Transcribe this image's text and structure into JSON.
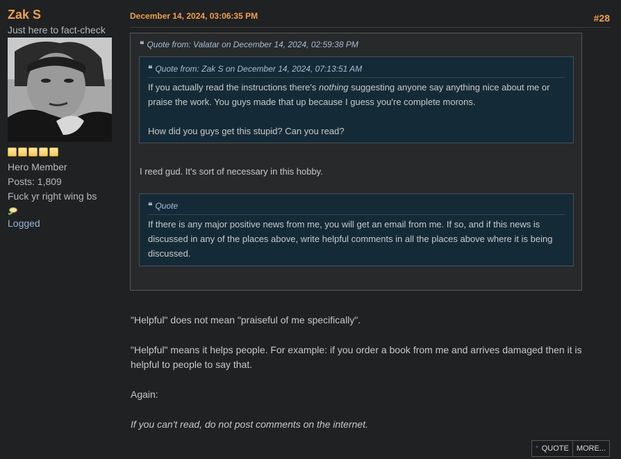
{
  "poster": {
    "name": "Zak S",
    "title": "Just here to fact-check",
    "rank": "Hero Member",
    "posts": "Posts: 1,809",
    "signature_line": "Fuck yr right wing bs",
    "logged": "Logged",
    "stars": 5,
    "star_color": "#f3c95a",
    "name_color": "#f0a04b"
  },
  "post": {
    "date": "December 14, 2024, 03:06:35 PM",
    "number": "#28",
    "outer_quote": {
      "cite": "Quote from: Valatar on December 14, 2024, 02:59:38 PM",
      "inner_quote": {
        "cite": "Quote from: Zak S on December 14, 2024, 07:13:51 AM",
        "line1_pre": "If you actually read the instructions there's ",
        "line1_em": "nothing",
        "line1_post": " suggesting anyone say anything nice about me or praise the work. You guys made that up because I guess you're complete morons.",
        "line2": "How did you guys get this stupid? Can you read?"
      },
      "reply": "I reed gud.  It's sort of necessary in this hobby.",
      "second_quote": {
        "cite": "Quote",
        "text": "If there is any major positive news from me, you will get an email from me. If so, and if this news is discussed in any of the places above, write helpful comments in all the places above where it is being discussed."
      }
    },
    "body": [
      "\"Helpful\" does not mean \"praiseful of me specifically\".",
      "\"Helpful\" means it helps people. For example: if you order a book from me and arrives damaged then it is helpful to people to say that.",
      "Again:",
      "If you can't read, do not post comments on the internet."
    ]
  },
  "buttons": {
    "quote_icon": "“",
    "quote": "QUOTE",
    "more": "MORE..."
  }
}
